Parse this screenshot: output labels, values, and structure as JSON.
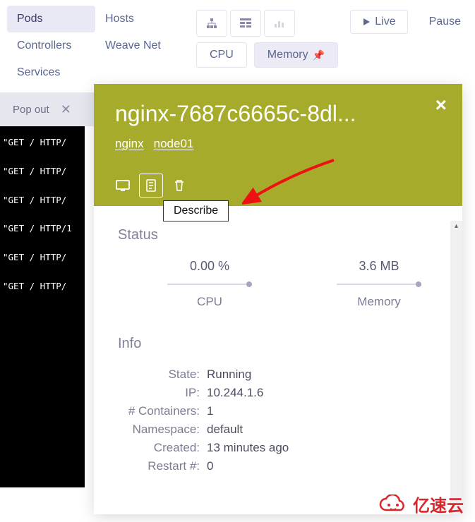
{
  "nav": {
    "col1": [
      "Pods",
      "Controllers",
      "Services"
    ],
    "col2": [
      "Hosts",
      "Weave Net"
    ],
    "active": "Pods"
  },
  "controls": {
    "live": "Live",
    "pause": "Pause"
  },
  "metric_tabs": {
    "cpu": "CPU",
    "memory": "Memory",
    "active": "Memory"
  },
  "popout": {
    "label": "Pop out"
  },
  "terminal_lines": [
    "\"GET / HTTP/",
    "\"GET / HTTP/",
    "\"GET / HTTP/",
    "\"GET / HTTP/1",
    "\"GET / HTTP/",
    "\"GET / HTTP/"
  ],
  "panel": {
    "title": "nginx-7687c6665c-8dl...",
    "sub": [
      "nginx",
      "node01"
    ],
    "tooltip": "Describe",
    "status_heading": "Status",
    "metrics": [
      {
        "value": "0.00 %",
        "label": "CPU"
      },
      {
        "value": "3.6 MB",
        "label": "Memory"
      }
    ],
    "info_heading": "Info",
    "info": [
      {
        "k": "State:",
        "v": "Running"
      },
      {
        "k": "IP:",
        "v": "10.244.1.6"
      },
      {
        "k": "# Containers:",
        "v": "1"
      },
      {
        "k": "Namespace:",
        "v": "default"
      },
      {
        "k": "Created:",
        "v": "13 minutes ago"
      },
      {
        "k": "Restart #:",
        "v": "0"
      }
    ]
  },
  "watermark": "亿速云"
}
